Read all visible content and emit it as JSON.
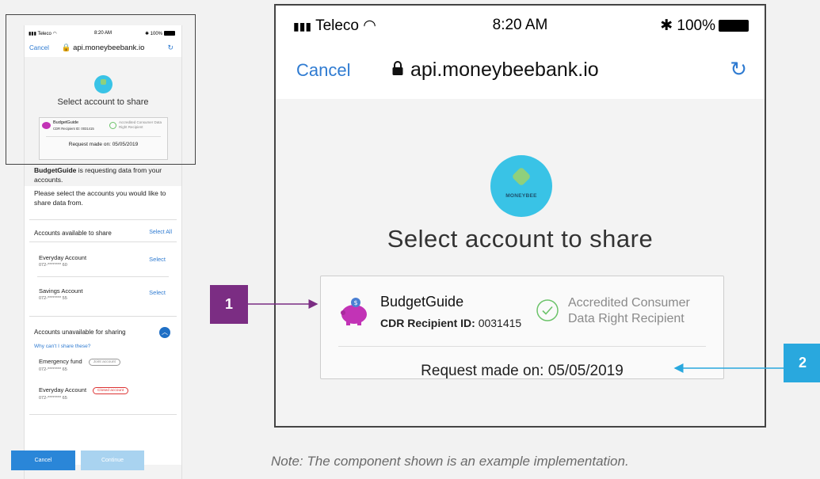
{
  "small_phone": {
    "status": {
      "carrier": "Teleco",
      "time": "8:20 AM",
      "battery": "100%"
    },
    "url_bar": {
      "cancel": "Cancel",
      "address": "api.moneybeebank.io"
    },
    "title": "Select account to share",
    "card": {
      "recipient_name": "BudgetGuide",
      "recipient_id": "CDR Recipient ID: 0031415",
      "accreditation": "Accredited Consumer Data Right Recipient",
      "request_date": "Request made on: 05/05/2019"
    },
    "intro_bold": "BudgetGuide",
    "intro_rest": " is requesting data from your accounts.",
    "instruction": "Please select the accounts you would like to share data from.",
    "available_section": {
      "label": "Accounts available to share",
      "select_all": "Select All"
    },
    "available_accounts": [
      {
        "name": "Everyday Account",
        "number": "072-******** 60",
        "action": "Select"
      },
      {
        "name": "Savings Account",
        "number": "072-******** 55",
        "action": "Select"
      }
    ],
    "unavailable_section": {
      "label": "Accounts unavailable for sharing",
      "help": "Why can't I share these?"
    },
    "unavailable_accounts": [
      {
        "name": "Emergency fund",
        "number": "072-******** 65",
        "badge": "Joint account"
      },
      {
        "name": "Everyday Account",
        "number": "072-******** 65",
        "badge": "Closed account"
      }
    ],
    "buttons": {
      "cancel": "Cancel",
      "continue": "Continue"
    }
  },
  "big_phone": {
    "status": {
      "carrier": "Teleco",
      "time": "8:20 AM",
      "battery": "100%"
    },
    "url_bar": {
      "cancel": "Cancel",
      "address": "api.moneybeebank.io"
    },
    "logo_text": "MONEYBEE",
    "title": "Select account to share",
    "card": {
      "recipient_name": "BudgetGuide",
      "recipient_id_label": "CDR Recipient ID:",
      "recipient_id": "0031415",
      "accreditation_line1": "Accredited Consumer",
      "accreditation_line2": "Data Right Recipient",
      "request_label": "Request made on:",
      "request_date": "05/05/2019"
    }
  },
  "callouts": {
    "one": "1",
    "two": "2"
  },
  "colors": {
    "link_blue": "#2f7bd1",
    "callout_purple": "#7b2d83",
    "callout_blue": "#29a8de",
    "logo_cyan": "#39c3e6"
  },
  "note": "Note: The component shown is an example implementation."
}
